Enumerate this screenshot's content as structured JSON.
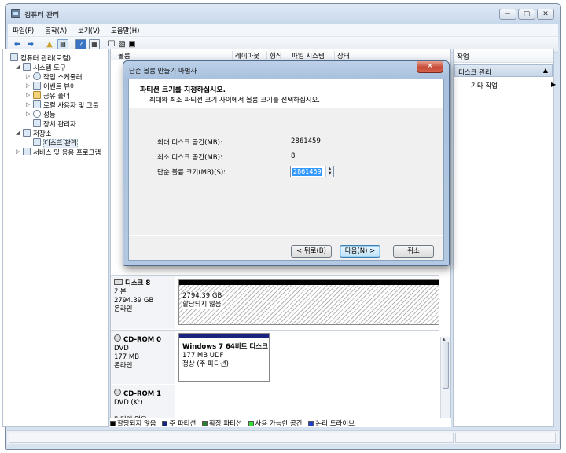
{
  "window": {
    "title": "컴퓨터 관리",
    "controls": [
      "−",
      "▢",
      "✕"
    ]
  },
  "menu": [
    "파일(F)",
    "동작(A)",
    "보기(V)",
    "도움말(H)"
  ],
  "tree": [
    {
      "label": "컴퓨터 관리(로컬)"
    },
    {
      "label": "시스템 도구"
    },
    {
      "label": "작업 스케줄러"
    },
    {
      "label": "이벤트 뷰어"
    },
    {
      "label": "공유 폴더"
    },
    {
      "label": "로컬 사용자 및 그룹"
    },
    {
      "label": "성능"
    },
    {
      "label": "장치 관리자"
    },
    {
      "label": "저장소"
    },
    {
      "label": "디스크 관리"
    },
    {
      "label": "서비스 및 응용 프로그램"
    }
  ],
  "columns": [
    "볼륨",
    "레이아웃",
    "형식",
    "파일 시스템",
    "상태"
  ],
  "disks": [
    {
      "name": "디스크 8",
      "type": "기본",
      "size": "2794.39 GB",
      "status": "온라인",
      "partition": {
        "size": "2794.39 GB",
        "state": "할당되지 않음"
      }
    },
    {
      "name": "CD-ROM 0",
      "type": "DVD",
      "size": "177 MB",
      "status": "온라인",
      "partition": {
        "label": "Windows 7 64비트 디스크",
        "detail": "177 MB UDF",
        "state": "정상 (주 파티션)"
      }
    },
    {
      "name": "CD-ROM 1",
      "type": "DVD (K:)",
      "size": "",
      "status": "미디어 없음"
    }
  ],
  "legend": [
    {
      "label": "할당되지 않음",
      "color": "#000000"
    },
    {
      "label": "주 파티션",
      "color": "#1a237e"
    },
    {
      "label": "확장 파티션",
      "color": "#2e7d32"
    },
    {
      "label": "사용 가능한 공간",
      "color": "#33dd33"
    },
    {
      "label": "논리 드라이브",
      "color": "#1f3fcf"
    }
  ],
  "actions": {
    "header": "작업",
    "section": "디스크 관리",
    "item": "기타 작업"
  },
  "dialog": {
    "title": "단순 볼륨 만들기 마법사",
    "heading": "파티션 크기를 지정하십시오.",
    "subheading": "최대와 최소 파티션 크기 사이에서 볼륨 크기를 선택하십시오.",
    "fields": [
      {
        "label": "최대 디스크 공간(MB):",
        "value": "2861459"
      },
      {
        "label": "최소 디스크 공간(MB):",
        "value": "8"
      },
      {
        "label": "단순 볼륨 크기(MB)(S):",
        "value": "2861459"
      }
    ],
    "buttons": {
      "back": "< 뒤로(B)",
      "next": "다음(N) >",
      "cancel": "취소"
    },
    "close": "✕"
  }
}
